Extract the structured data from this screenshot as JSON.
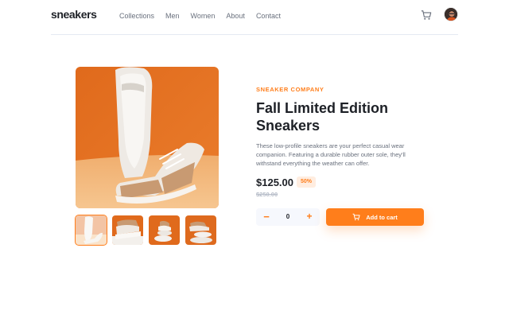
{
  "header": {
    "logo": "sneakers",
    "nav": [
      "Collections",
      "Men",
      "Women",
      "About",
      "Contact"
    ]
  },
  "product": {
    "company": "SNEAKER COMPANY",
    "title": "Fall Limited Edition Sneakers",
    "description": "These low-profile sneakers are your perfect casual wear companion. Featuring a durable rubber outer sole, they'll withstand everything the weather can offer.",
    "price": "$125.00",
    "discount": "50%",
    "original_price": "$250.00"
  },
  "cart_controls": {
    "quantity": "0",
    "minus": "−",
    "plus": "+",
    "add_label": "Add to cart"
  },
  "gallery": {
    "selected_thumbnail": 1,
    "thumbnail_count": 4
  },
  "icons": {
    "header_cart": "cart-icon",
    "add_cart": "cart-icon",
    "avatar": "user-avatar"
  },
  "colors": {
    "accent": "#ff7e1b",
    "accent_pale": "#ffede0",
    "dark": "#1d2026",
    "grey": "#69707d",
    "light_grey": "#b6bcc8",
    "qty_bg": "#f6f8fd"
  }
}
